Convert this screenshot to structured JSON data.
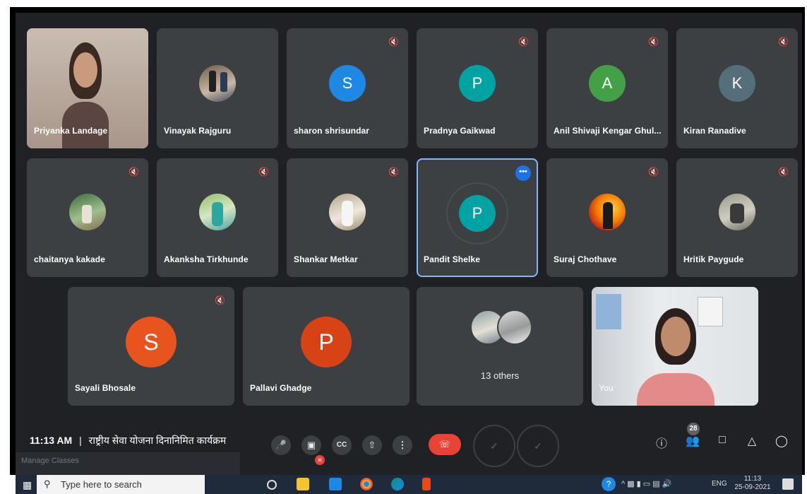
{
  "participants": [
    {
      "name": "Priyanka Landage",
      "type": "video"
    },
    {
      "name": "Vinayak Rajguru",
      "type": "photo"
    },
    {
      "name": "sharon shrisundar",
      "initial": "S",
      "color": "#1e88e5"
    },
    {
      "name": "Pradnya Gaikwad",
      "initial": "P",
      "color": "#00a3a3"
    },
    {
      "name": "Anil Shivaji Kengar Ghul...",
      "initial": "A",
      "color": "#43a047"
    },
    {
      "name": "Kiran Ranadive",
      "initial": "K",
      "color": "#546e7a"
    },
    {
      "name": "chaitanya kakade",
      "type": "photo"
    },
    {
      "name": "Akanksha Tirkhunde",
      "type": "photo"
    },
    {
      "name": "Shankar Metkar",
      "type": "photo"
    },
    {
      "name": "Pandit Shelke",
      "initial": "P",
      "color": "#00a3a3"
    },
    {
      "name": "Suraj Chothave",
      "type": "photo"
    },
    {
      "name": "Hritik Paygude",
      "type": "photo"
    },
    {
      "name": "Sayali Bhosale",
      "initial": "S",
      "color": "#e8541e"
    },
    {
      "name": "Pallavi Ghadge",
      "initial": "P",
      "color": "#d84315"
    },
    {
      "others_label": "13 others"
    },
    {
      "name": "You",
      "type": "video"
    }
  ],
  "meeting": {
    "time": "11:13 AM",
    "separator": "|",
    "title": "राष्ट्रीय सेवा योजना दिनानिमित कार्यक्रम",
    "people_count": "28"
  },
  "taskbar": {
    "search_placeholder": "Type here to search",
    "clock_time": "11:13",
    "clock_date": "25-09-2021",
    "language": "ENG"
  },
  "notification": {
    "label": "Manage Classes"
  },
  "icons": {
    "mic": "mic-icon",
    "camera": "camera-icon",
    "captions": "captions-icon",
    "present": "present-icon",
    "more": "more-options-icon",
    "end_call": "end-call-icon",
    "info": "info-icon",
    "people": "people-icon",
    "chat": "chat-icon",
    "activities": "activities-icon",
    "host_controls": "host-controls-icon"
  },
  "colors": {
    "background": "#202124",
    "tile": "#3c4043",
    "end_call": "#ea4335",
    "highlight": "#8ab4f8"
  }
}
